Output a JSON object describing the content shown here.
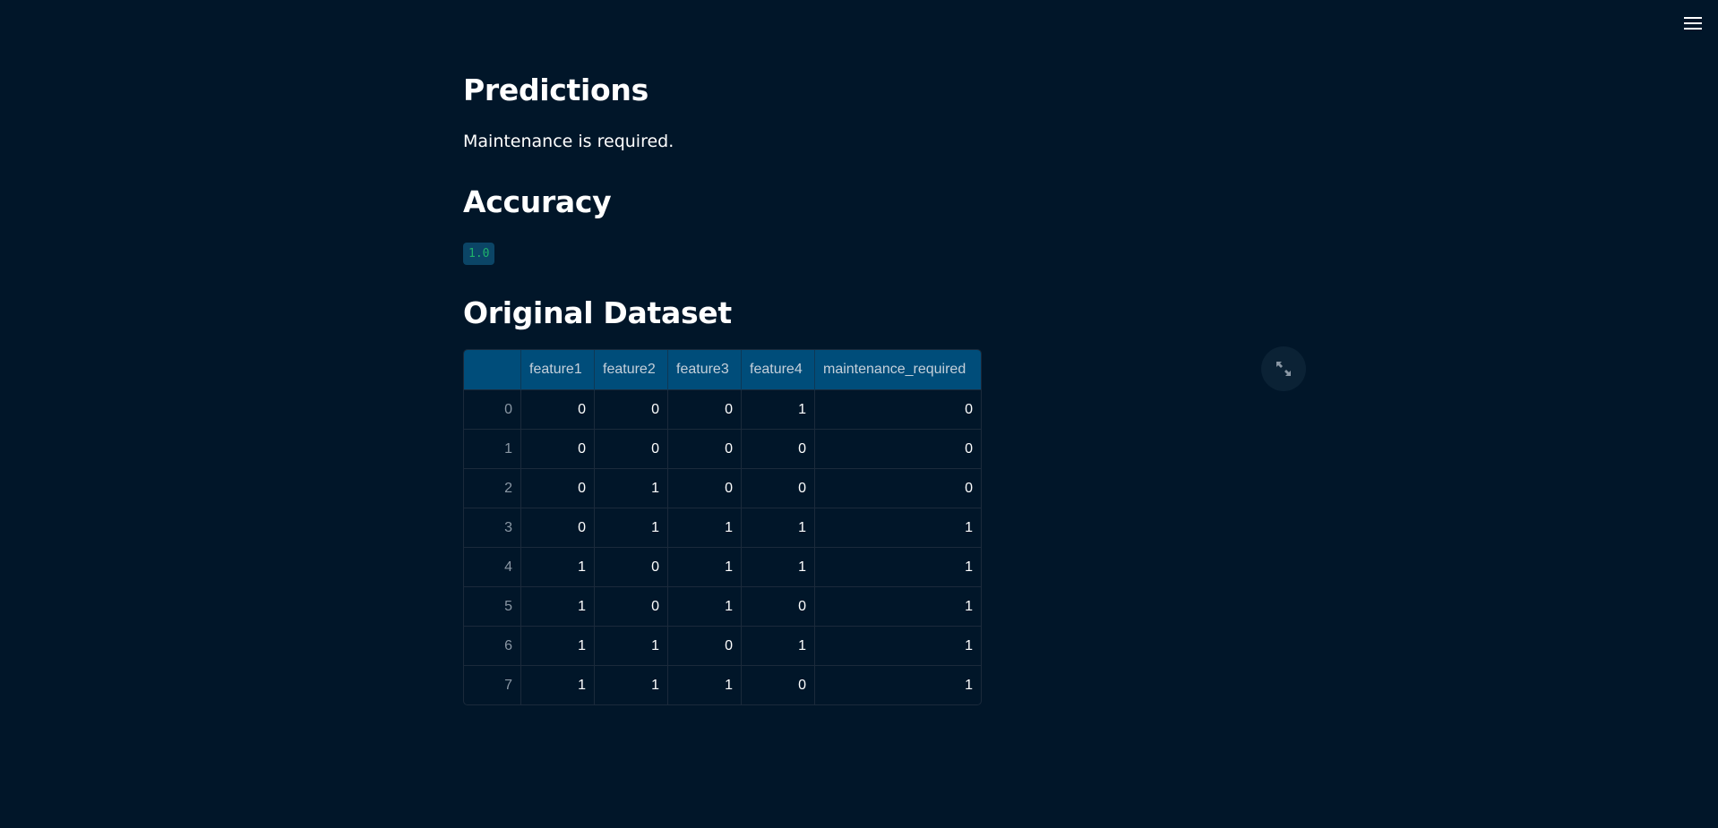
{
  "header": {
    "menu_icon": "hamburger-menu-icon"
  },
  "predictions": {
    "heading": "Predictions",
    "message": "Maintenance is required."
  },
  "accuracy": {
    "heading": "Accuracy",
    "value": "1.0"
  },
  "dataset": {
    "heading": "Original Dataset",
    "fullscreen_icon": "expand-icon",
    "columns": [
      "",
      "feature1",
      "feature2",
      "feature3",
      "feature4",
      "maintenance_required"
    ],
    "rows": [
      [
        "0",
        "0",
        "0",
        "0",
        "1",
        "0"
      ],
      [
        "1",
        "0",
        "0",
        "0",
        "0",
        "0"
      ],
      [
        "2",
        "0",
        "1",
        "0",
        "0",
        "0"
      ],
      [
        "3",
        "0",
        "1",
        "1",
        "1",
        "1"
      ],
      [
        "4",
        "1",
        "0",
        "1",
        "1",
        "1"
      ],
      [
        "5",
        "1",
        "0",
        "1",
        "0",
        "1"
      ],
      [
        "6",
        "1",
        "1",
        "0",
        "1",
        "1"
      ],
      [
        "7",
        "1",
        "1",
        "1",
        "0",
        "1"
      ]
    ]
  },
  "colors": {
    "background": "#011629",
    "table_header": "#004d7a",
    "code_text": "#1fb26a",
    "code_background": "#0b4566"
  }
}
